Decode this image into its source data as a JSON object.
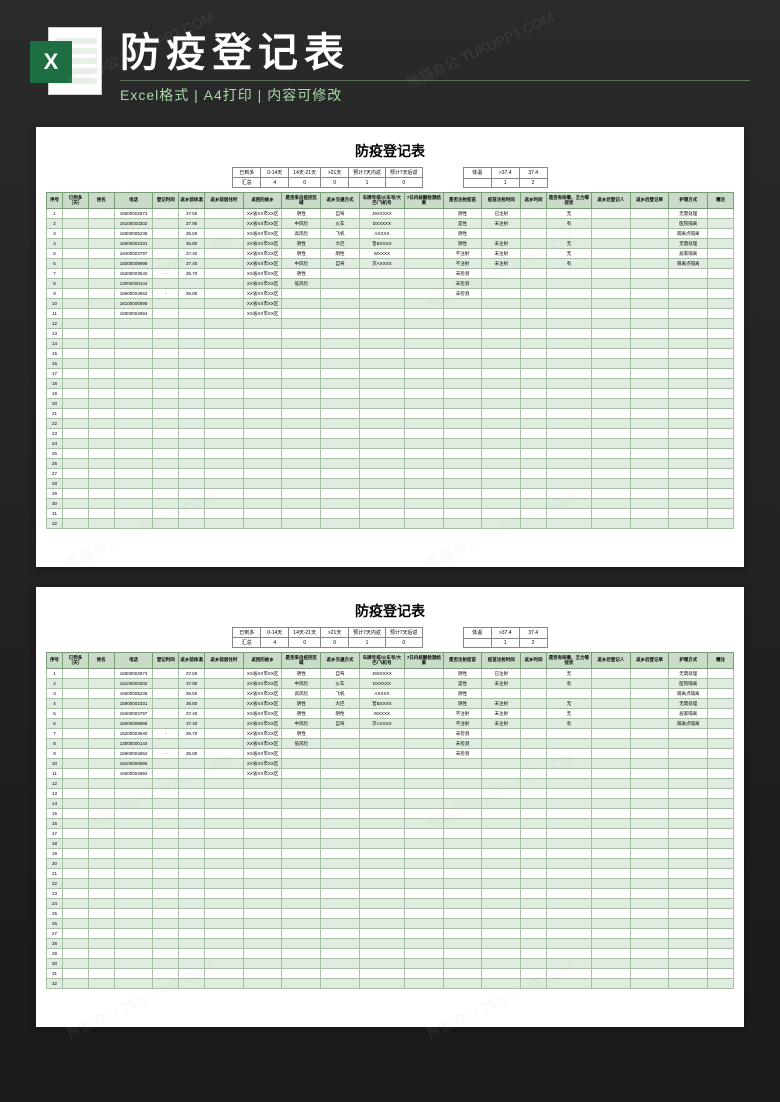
{
  "header": {
    "excel_letter": "X",
    "title": "防疫登记表",
    "subtitle": "Excel格式 | A4打印 | 内容可修改"
  },
  "watermark_text": "熊猫办公 TUKUPPT.COM",
  "sheet": {
    "title": "防疫登记表",
    "summary_left": {
      "headers": [
        "已到多",
        "0-14天",
        "14天-21天",
        ">21天",
        "预计7天内返",
        "预计7天后返"
      ],
      "row_label": "汇总",
      "values": [
        "4",
        "0",
        "0",
        "1",
        "0"
      ]
    },
    "summary_right": {
      "headers": [
        "体温",
        ">37.4",
        "37.4"
      ],
      "values": [
        "1",
        "2"
      ]
    },
    "columns": [
      "序号",
      "已到多（天）",
      "姓名",
      "电话",
      "登记时间",
      "返乡前体温",
      "返乡前居住时",
      "返回的故乡",
      "是否来自疫控区域",
      "返乡交通方式",
      "车牌号或/火车号/大巴/飞机号",
      "7日内核酸检测结果",
      "是否注射疫苗",
      "疫苗注射时间",
      "返乡时间",
      "是否有咳嗽、乏力等症状",
      "返乡后登记人",
      "返乡后登记单",
      "护理方式",
      "赠注"
    ],
    "rows": [
      {
        "c": [
          "1",
          "",
          "",
          "15000002873",
          "",
          "37.50",
          "",
          "XX省XX市XX区",
          "阴性",
          "自驾",
          "J9XXXXX",
          "",
          "阴性",
          "已注射",
          "",
          "无",
          "",
          "",
          "无需处理",
          ""
        ]
      },
      {
        "c": [
          "2",
          "",
          "",
          "15100003302",
          "",
          "37.90",
          "",
          "XX省XX市XX区",
          "中风险",
          "火车",
          "DXXXXX",
          "",
          "是性",
          "未注射",
          "",
          "有",
          "",
          "",
          "医院隔离",
          ""
        ]
      },
      {
        "c": [
          "3",
          "",
          "",
          "15000005239",
          "",
          "36.50",
          "",
          "XX省XX市XX区",
          "高风险",
          "飞机",
          "AXXXX",
          "",
          "阴性",
          "",
          "",
          "",
          "",
          "",
          "隔离点隔离",
          ""
        ]
      },
      {
        "c": [
          "4",
          "",
          "",
          "15900002331",
          "",
          "36.80",
          "",
          "XX省XX市XX区",
          "阴性",
          "大巴",
          "晋BXXXX",
          "",
          "阴性",
          "未注射",
          "",
          "无",
          "",
          "",
          "无需处理",
          ""
        ]
      },
      {
        "c": [
          "5",
          "",
          "",
          "18400003797",
          "",
          "37.40",
          "",
          "XX省XX市XX区",
          "阴性",
          "阴性",
          "WXXXX",
          "",
          "不注射",
          "未注射",
          "",
          "无",
          "",
          "",
          "居家隔离",
          ""
        ]
      },
      {
        "c": [
          "6",
          "",
          "",
          "15000009998",
          "",
          "37.40",
          "",
          "XX省XX市XX区",
          "中风险",
          "自驾",
          "京AXXXX",
          "",
          "不注射",
          "未注射",
          "",
          "有",
          "",
          "",
          "隔离点隔离",
          ""
        ]
      },
      {
        "c": [
          "7",
          "",
          "",
          "15200003540",
          "-",
          "36.70",
          "",
          "XX省XX市XX区",
          "阴性",
          "",
          "",
          "",
          "未检测",
          "",
          "",
          "",
          "",
          "",
          "",
          ""
        ]
      },
      {
        "c": [
          "8",
          "",
          "",
          "13000000144",
          "",
          "",
          "",
          "XX省XX市XX区",
          "低风险",
          "",
          "",
          "",
          "未检测",
          "",
          "",
          "",
          "",
          "",
          "",
          ""
        ]
      },
      {
        "c": [
          "9",
          "",
          "",
          "15900004652",
          "-",
          "36.80",
          "",
          "XX省XX市XX区",
          "",
          "",
          "",
          "",
          "未检测",
          "",
          "",
          "",
          "",
          "",
          "",
          ""
        ]
      },
      {
        "c": [
          "10",
          "",
          "",
          "18100000895",
          "",
          "",
          "",
          "XX省XX市XX区",
          "",
          "",
          "",
          "",
          "",
          "",
          "",
          "",
          "",
          "",
          "",
          ""
        ]
      },
      {
        "c": [
          "11",
          "",
          "",
          "15000004994",
          "",
          "",
          "",
          "XX省XX市XX区",
          "",
          "",
          "",
          "",
          "",
          "",
          "",
          "",
          "",
          "",
          "",
          ""
        ]
      },
      {
        "c": [
          "12",
          "",
          "",
          "",
          "",
          "",
          "",
          "",
          "",
          "",
          "",
          "",
          "",
          "",
          "",
          "",
          "",
          "",
          "",
          ""
        ]
      },
      {
        "c": [
          "13",
          "",
          "",
          "",
          "",
          "",
          "",
          "",
          "",
          "",
          "",
          "",
          "",
          "",
          "",
          "",
          "",
          "",
          "",
          ""
        ]
      },
      {
        "c": [
          "14",
          "",
          "",
          "",
          "",
          "",
          "",
          "",
          "",
          "",
          "",
          "",
          "",
          "",
          "",
          "",
          "",
          "",
          "",
          ""
        ]
      },
      {
        "c": [
          "15",
          "",
          "",
          "",
          "",
          "",
          "",
          "",
          "",
          "",
          "",
          "",
          "",
          "",
          "",
          "",
          "",
          "",
          "",
          ""
        ]
      },
      {
        "c": [
          "16",
          "",
          "",
          "",
          "",
          "",
          "",
          "",
          "",
          "",
          "",
          "",
          "",
          "",
          "",
          "",
          "",
          "",
          "",
          ""
        ]
      },
      {
        "c": [
          "17",
          "",
          "",
          "",
          "",
          "",
          "",
          "",
          "",
          "",
          "",
          "",
          "",
          "",
          "",
          "",
          "",
          "",
          "",
          ""
        ]
      },
      {
        "c": [
          "18",
          "",
          "",
          "",
          "",
          "",
          "",
          "",
          "",
          "",
          "",
          "",
          "",
          "",
          "",
          "",
          "",
          "",
          "",
          ""
        ]
      },
      {
        "c": [
          "19",
          "",
          "",
          "",
          "",
          "",
          "",
          "",
          "",
          "",
          "",
          "",
          "",
          "",
          "",
          "",
          "",
          "",
          "",
          ""
        ]
      },
      {
        "c": [
          "20",
          "",
          "",
          "",
          "",
          "",
          "",
          "",
          "",
          "",
          "",
          "",
          "",
          "",
          "",
          "",
          "",
          "",
          "",
          ""
        ]
      },
      {
        "c": [
          "21",
          "",
          "",
          "",
          "",
          "",
          "",
          "",
          "",
          "",
          "",
          "",
          "",
          "",
          "",
          "",
          "",
          "",
          "",
          ""
        ]
      },
      {
        "c": [
          "22",
          "",
          "",
          "",
          "",
          "",
          "",
          "",
          "",
          "",
          "",
          "",
          "",
          "",
          "",
          "",
          "",
          "",
          "",
          ""
        ]
      },
      {
        "c": [
          "23",
          "",
          "",
          "",
          "",
          "",
          "",
          "",
          "",
          "",
          "",
          "",
          "",
          "",
          "",
          "",
          "",
          "",
          "",
          ""
        ]
      },
      {
        "c": [
          "24",
          "",
          "",
          "",
          "",
          "",
          "",
          "",
          "",
          "",
          "",
          "",
          "",
          "",
          "",
          "",
          "",
          "",
          "",
          ""
        ]
      },
      {
        "c": [
          "25",
          "",
          "",
          "",
          "",
          "",
          "",
          "",
          "",
          "",
          "",
          "",
          "",
          "",
          "",
          "",
          "",
          "",
          "",
          ""
        ]
      },
      {
        "c": [
          "26",
          "",
          "",
          "",
          "",
          "",
          "",
          "",
          "",
          "",
          "",
          "",
          "",
          "",
          "",
          "",
          "",
          "",
          "",
          ""
        ]
      },
      {
        "c": [
          "27",
          "",
          "",
          "",
          "",
          "",
          "",
          "",
          "",
          "",
          "",
          "",
          "",
          "",
          "",
          "",
          "",
          "",
          "",
          ""
        ]
      },
      {
        "c": [
          "28",
          "",
          "",
          "",
          "",
          "",
          "",
          "",
          "",
          "",
          "",
          "",
          "",
          "",
          "",
          "",
          "",
          "",
          "",
          ""
        ]
      },
      {
        "c": [
          "29",
          "",
          "",
          "",
          "",
          "",
          "",
          "",
          "",
          "",
          "",
          "",
          "",
          "",
          "",
          "",
          "",
          "",
          "",
          ""
        ]
      },
      {
        "c": [
          "30",
          "",
          "",
          "",
          "",
          "",
          "",
          "",
          "",
          "",
          "",
          "",
          "",
          "",
          "",
          "",
          "",
          "",
          "",
          ""
        ]
      },
      {
        "c": [
          "31",
          "",
          "",
          "",
          "",
          "",
          "",
          "",
          "",
          "",
          "",
          "",
          "",
          "",
          "",
          "",
          "",
          "",
          "",
          ""
        ]
      },
      {
        "c": [
          "32",
          "",
          "",
          "",
          "",
          "",
          "",
          "",
          "",
          "",
          "",
          "",
          "",
          "",
          "",
          "",
          "",
          "",
          "",
          ""
        ]
      }
    ]
  }
}
